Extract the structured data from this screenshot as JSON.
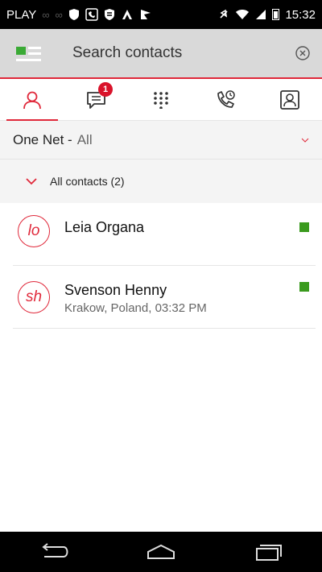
{
  "status_bar": {
    "carrier": "PLAY",
    "time": "15:32"
  },
  "search": {
    "placeholder": "Search contacts"
  },
  "tabs": [
    {
      "icon": "person-icon",
      "active": true
    },
    {
      "icon": "chat-icon",
      "badge": "1"
    },
    {
      "icon": "dialpad-icon"
    },
    {
      "icon": "call-history-icon"
    },
    {
      "icon": "contact-card-icon"
    }
  ],
  "filter": {
    "name": "One Net -",
    "value": "All"
  },
  "group": {
    "title": "All contacts (2)"
  },
  "contacts": [
    {
      "initials": "lo",
      "name": "Leia Organa",
      "subtitle": "",
      "presence_color": "#3a9a1e"
    },
    {
      "initials": "sh",
      "name": "Svenson Henny",
      "subtitle": "Krakow, Poland, 03:32 PM",
      "presence_color": "#3a9a1e"
    }
  ],
  "colors": {
    "accent": "#e0283a",
    "presence_online": "#3a9a1e",
    "badge": "#d9132b"
  }
}
